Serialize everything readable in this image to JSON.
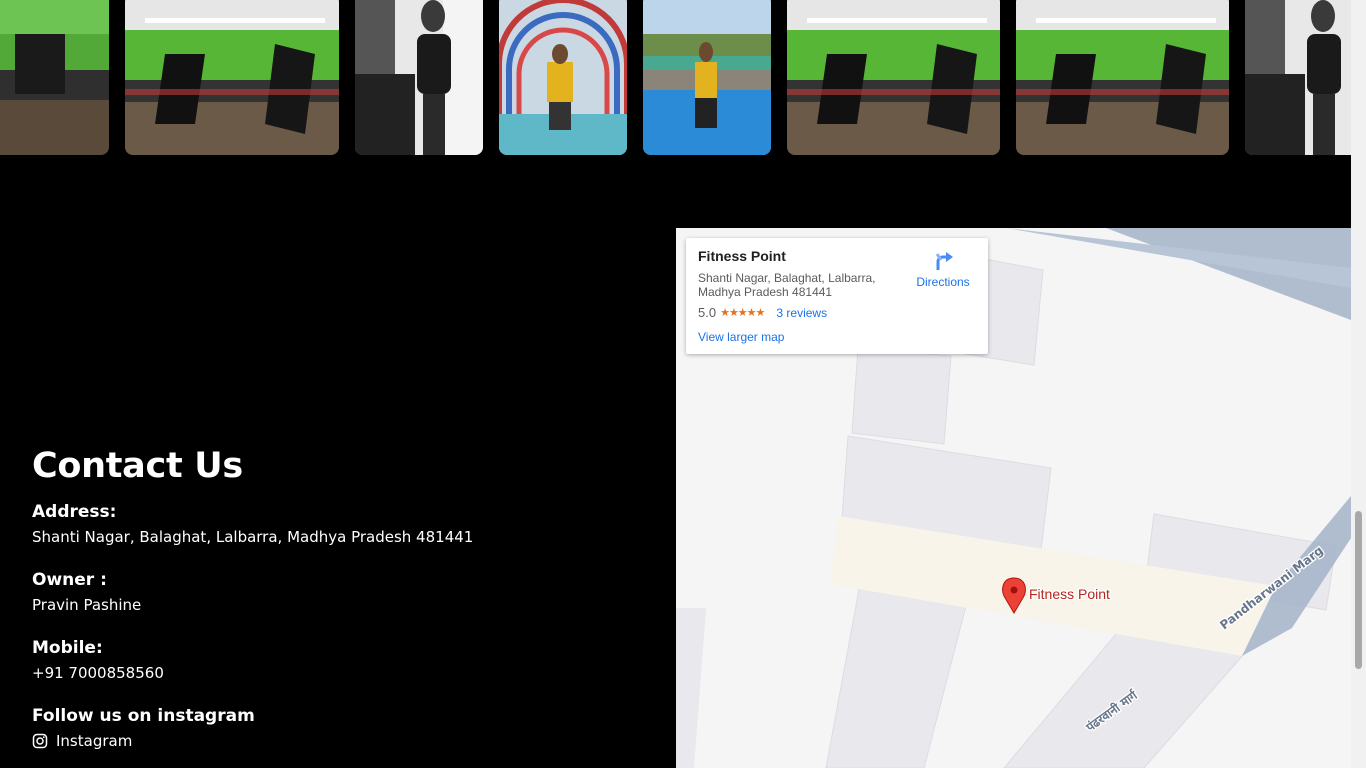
{
  "gallery": {
    "photos": [
      {
        "name": "gym-floor-photo",
        "scene": "gym"
      },
      {
        "name": "gym-floor-photo",
        "scene": "gym"
      },
      {
        "name": "trainer-portrait-photo",
        "scene": "portrait-bw"
      },
      {
        "name": "water-park-arch-photo",
        "scene": "waterpark-arch"
      },
      {
        "name": "pool-photo",
        "scene": "pool"
      },
      {
        "name": "gym-floor-photo",
        "scene": "gym"
      },
      {
        "name": "gym-floor-photo",
        "scene": "gym"
      },
      {
        "name": "trainer-portrait-photo",
        "scene": "portrait-bw"
      }
    ]
  },
  "contact": {
    "heading": "Contact Us",
    "address_label": "Address:",
    "address": "Shanti Nagar, Balaghat, Lalbarra, Madhya Pradesh 481441",
    "owner_label": "Owner :",
    "owner": "Pravin Pashine",
    "mobile_label": "Mobile:",
    "mobile": "+91 7000858560",
    "instagram_label": "Follow us on instagram",
    "instagram_link": "Instagram",
    "instagram_icon": "instagram-icon"
  },
  "map": {
    "place_name": "Fitness Point",
    "address": "Shanti Nagar, Balaghat, Lalbarra, Madhya Pradesh 481441",
    "rating": "5.0",
    "stars": "★★★★★",
    "reviews": "3 reviews",
    "view_larger": "View larger map",
    "directions": "Directions",
    "marker_label": "Fitness Point",
    "road_label_1": "Pandharwani Marg",
    "road_label_2": "पंढरवानी मार्ग",
    "colors": {
      "link": "#1a73e8",
      "star": "#e7711b",
      "pin": "#ea4335",
      "marker_text": "#b3261e",
      "road_major": "#a3b3c8",
      "road_highlight": "#f8f4ea",
      "building": "#e8e8ed"
    }
  }
}
